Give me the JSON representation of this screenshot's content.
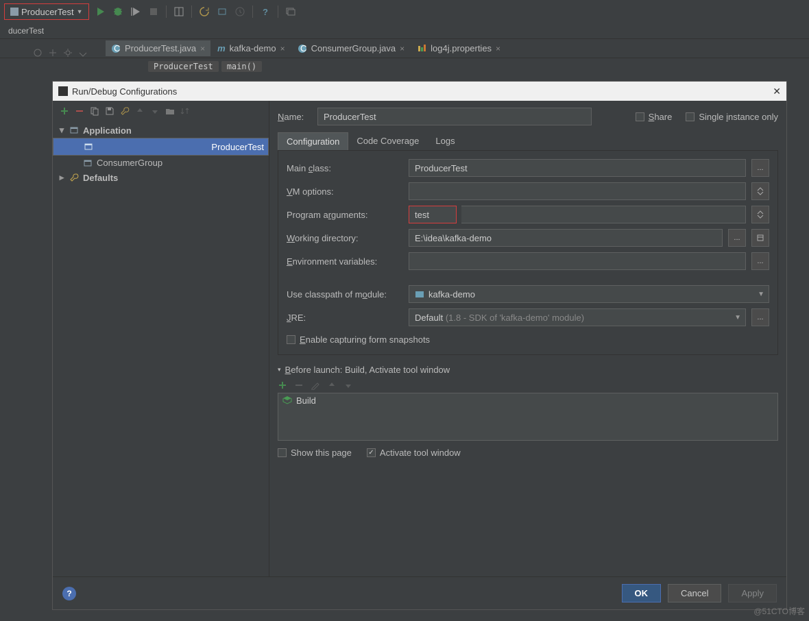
{
  "toolbar": {
    "run_config": "ProducerTest"
  },
  "crumb": "ducerTest",
  "editor_tabs": [
    {
      "label": "ProducerTest.java",
      "active": true
    },
    {
      "label": "kafka-demo",
      "active": false
    },
    {
      "label": "ConsumerGroup.java",
      "active": false
    },
    {
      "label": "log4j.properties",
      "active": false
    }
  ],
  "breadcrumbs": {
    "a": "ProducerTest",
    "b": "main()"
  },
  "dialog": {
    "title": "Run/Debug Configurations",
    "tree": {
      "application": "Application",
      "items": {
        "a": "ProducerTest",
        "b": "ConsumerGroup"
      },
      "defaults": "Defaults"
    },
    "name_label": "Name:",
    "name_value": "ProducerTest",
    "share": "Share",
    "single": "Single instance only",
    "tabs": {
      "configuration": "Configuration",
      "coverage": "Code Coverage",
      "logs": "Logs"
    },
    "form": {
      "main_class_label": "Main class:",
      "main_class": "ProducerTest",
      "vm_label": "VM options:",
      "vm": "",
      "args_label": "Program arguments:",
      "args": "test",
      "wd_label": "Working directory:",
      "wd": "E:\\idea\\kafka-demo",
      "env_label": "Environment variables:",
      "env": "",
      "module_label": "Use classpath of module:",
      "module": "kafka-demo",
      "jre_label": "JRE:",
      "jre": "Default",
      "jre_hint": "(1.8 - SDK of 'kafka-demo' module)",
      "snapshots": "Enable capturing form snapshots"
    },
    "before": {
      "header": "Before launch: Build, Activate tool window",
      "build": "Build"
    },
    "show_page": "Show this page",
    "activate_tool": "Activate tool window",
    "buttons": {
      "ok": "OK",
      "cancel": "Cancel",
      "apply": "Apply"
    }
  },
  "watermark": "@51CTO博客"
}
